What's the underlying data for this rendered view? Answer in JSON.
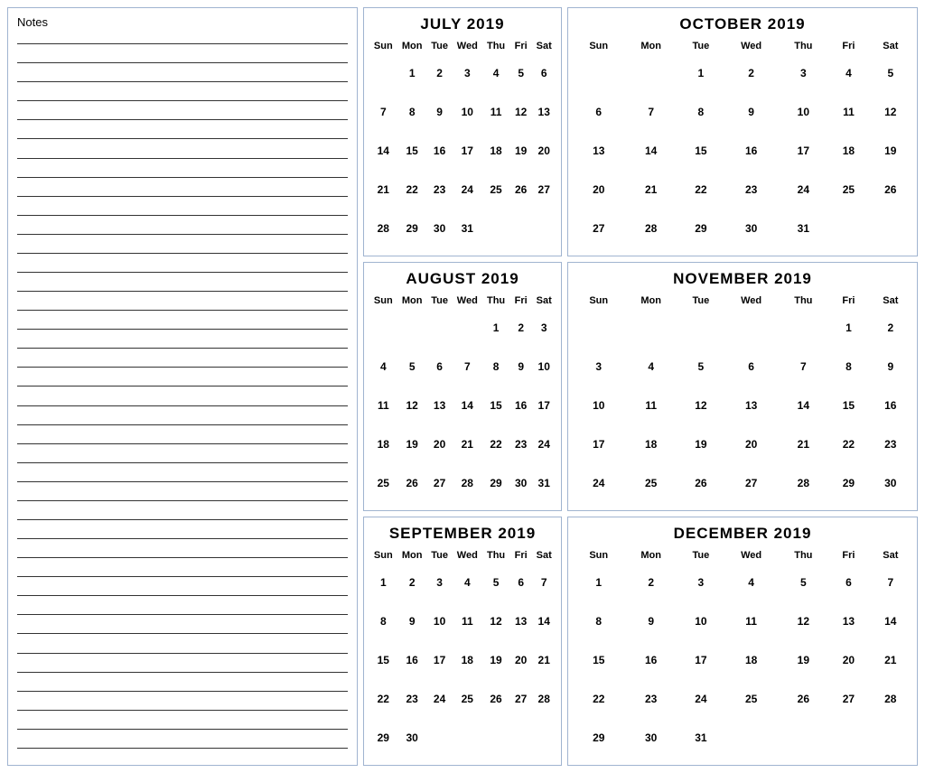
{
  "notes": {
    "label": "Notes"
  },
  "calendars": [
    {
      "id": "july-2019",
      "title": "JULY 2019",
      "headers": [
        "Sun",
        "Mon",
        "Tue",
        "Wed",
        "Thu",
        "Fri",
        "Sat"
      ],
      "weeks": [
        [
          "",
          "1",
          "2",
          "3",
          "4",
          "5",
          "6"
        ],
        [
          "7",
          "8",
          "9",
          "10",
          "11",
          "12",
          "13"
        ],
        [
          "14",
          "15",
          "16",
          "17",
          "18",
          "19",
          "20"
        ],
        [
          "21",
          "22",
          "23",
          "24",
          "25",
          "26",
          "27"
        ],
        [
          "28",
          "29",
          "30",
          "31",
          "",
          "",
          ""
        ]
      ]
    },
    {
      "id": "october-2019",
      "title": "OCTOBER 2019",
      "headers": [
        "Sun",
        "Mon",
        "Tue",
        "Wed",
        "Thu",
        "Fri",
        "Sat"
      ],
      "weeks": [
        [
          "",
          "",
          "1",
          "2",
          "3",
          "4",
          "5"
        ],
        [
          "6",
          "7",
          "8",
          "9",
          "10",
          "11",
          "12"
        ],
        [
          "13",
          "14",
          "15",
          "16",
          "17",
          "18",
          "19"
        ],
        [
          "20",
          "21",
          "22",
          "23",
          "24",
          "25",
          "26"
        ],
        [
          "27",
          "28",
          "29",
          "30",
          "31",
          "",
          ""
        ]
      ]
    },
    {
      "id": "august-2019",
      "title": "AUGUST 2019",
      "headers": [
        "Sun",
        "Mon",
        "Tue",
        "Wed",
        "Thu",
        "Fri",
        "Sat"
      ],
      "weeks": [
        [
          "",
          "",
          "",
          "",
          "1",
          "2",
          "3"
        ],
        [
          "4",
          "5",
          "6",
          "7",
          "8",
          "9",
          "10"
        ],
        [
          "11",
          "12",
          "13",
          "14",
          "15",
          "16",
          "17"
        ],
        [
          "18",
          "19",
          "20",
          "21",
          "22",
          "23",
          "24"
        ],
        [
          "25",
          "26",
          "27",
          "28",
          "29",
          "30",
          "31"
        ]
      ]
    },
    {
      "id": "november-2019",
      "title": "NOVEMBER 2019",
      "headers": [
        "Sun",
        "Mon",
        "Tue",
        "Wed",
        "Thu",
        "Fri",
        "Sat"
      ],
      "weeks": [
        [
          "",
          "",
          "",
          "",
          "",
          "1",
          "2"
        ],
        [
          "3",
          "4",
          "5",
          "6",
          "7",
          "8",
          "9"
        ],
        [
          "10",
          "11",
          "12",
          "13",
          "14",
          "15",
          "16"
        ],
        [
          "17",
          "18",
          "19",
          "20",
          "21",
          "22",
          "23"
        ],
        [
          "24",
          "25",
          "26",
          "27",
          "28",
          "29",
          "30"
        ]
      ]
    },
    {
      "id": "september-2019",
      "title": "SEPTEMBER 2019",
      "headers": [
        "Sun",
        "Mon",
        "Tue",
        "Wed",
        "Thu",
        "Fri",
        "Sat"
      ],
      "weeks": [
        [
          "1",
          "2",
          "3",
          "4",
          "5",
          "6",
          "7"
        ],
        [
          "8",
          "9",
          "10",
          "11",
          "12",
          "13",
          "14"
        ],
        [
          "15",
          "16",
          "17",
          "18",
          "19",
          "20",
          "21"
        ],
        [
          "22",
          "23",
          "24",
          "25",
          "26",
          "27",
          "28"
        ],
        [
          "29",
          "30",
          "",
          "",
          "",
          "",
          ""
        ]
      ]
    },
    {
      "id": "december-2019",
      "title": "DECEMBER 2019",
      "headers": [
        "Sun",
        "Mon",
        "Tue",
        "Wed",
        "Thu",
        "Fri",
        "Sat"
      ],
      "weeks": [
        [
          "1",
          "2",
          "3",
          "4",
          "5",
          "6",
          "7"
        ],
        [
          "8",
          "9",
          "10",
          "11",
          "12",
          "13",
          "14"
        ],
        [
          "15",
          "16",
          "17",
          "18",
          "19",
          "20",
          "21"
        ],
        [
          "22",
          "23",
          "24",
          "25",
          "26",
          "27",
          "28"
        ],
        [
          "29",
          "30",
          "31",
          "",
          "",
          "",
          ""
        ]
      ]
    }
  ]
}
